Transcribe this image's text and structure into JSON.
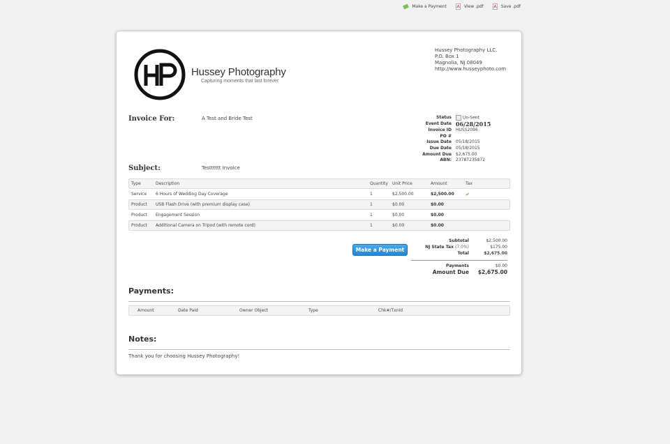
{
  "toolbar": {
    "make_payment": "Make a Payment",
    "view_pdf": "View .pdf",
    "save_pdf": "Save .pdf"
  },
  "logo": {
    "brand": "Hussey Photography",
    "tagline": "Capturing moments that last forever"
  },
  "company": {
    "name": "Hussey Photography LLC.",
    "address1": "P.O. Box 1",
    "address2": "Magnolia, NJ 08049",
    "website": "http://www.husseyphoto.com"
  },
  "invoice_for": {
    "label": "Invoice For:",
    "value": "A Test and Bride Test"
  },
  "subject": {
    "label": "Subject:",
    "value": "Testttttt Invoice"
  },
  "meta": {
    "status_label": "Status",
    "status_value": "Un-Sent",
    "event_date_label": "Event Date",
    "event_date_value": "06/28/2015",
    "invoice_id_label": "Invoice ID",
    "invoice_id_value": "HUSS2096",
    "po_label": "PO #",
    "po_value": "",
    "issue_date_label": "Issue Date",
    "issue_date_value": "05/18/2015",
    "due_date_label": "Due Date",
    "due_date_value": "05/18/2015",
    "amount_due_label": "Amount Due",
    "amount_due_value": "$2,675.00",
    "abn_label": "ABN:",
    "abn_value": "23787235872"
  },
  "items_table": {
    "headers": [
      "Type",
      "Description",
      "Quantity",
      "Unit Price",
      "Amount",
      "Tax"
    ],
    "rows": [
      {
        "type": "Service",
        "description": "6 Hours of Wedding Day Coverage",
        "quantity": "1",
        "unit_price": "$2,500.00",
        "amount": "$2,500.00",
        "taxed": true
      },
      {
        "type": "Product",
        "description": "USB Flash Drive (with premium display case)",
        "quantity": "1",
        "unit_price": "$0.00",
        "amount": "$0.00",
        "taxed": false
      },
      {
        "type": "Product",
        "description": "Engagement Session",
        "quantity": "1",
        "unit_price": "$0.00",
        "amount": "$0.00",
        "taxed": false
      },
      {
        "type": "Product",
        "description": "Additional Camera on Tripod (with remote cord)",
        "quantity": "1",
        "unit_price": "$0.00",
        "amount": "$0.00",
        "taxed": false
      }
    ]
  },
  "pay_button": "Make a Payment",
  "totals": {
    "subtotal_label": "Subtotal",
    "subtotal_value": "$2,500.00",
    "tax_label": "NJ State Tax",
    "tax_pct": "(7.0%)",
    "tax_value": "$175.00",
    "total_label": "Total",
    "total_value": "$2,675.00",
    "payments_label": "Payments",
    "payments_value": "$0.00",
    "amount_due_label": "Amount Due",
    "amount_due_value": "$2,675.00"
  },
  "payments": {
    "title": "Payments:",
    "headers": [
      "Amount",
      "Date Paid",
      "Owner Object",
      "Type",
      "Chk#/TxnId"
    ]
  },
  "notes": {
    "title": "Notes:",
    "text": "Thank you for choosing Hussey Photography!"
  },
  "colors": {
    "accent": "#2a8fdc",
    "tax_check": "#6aa52a"
  }
}
